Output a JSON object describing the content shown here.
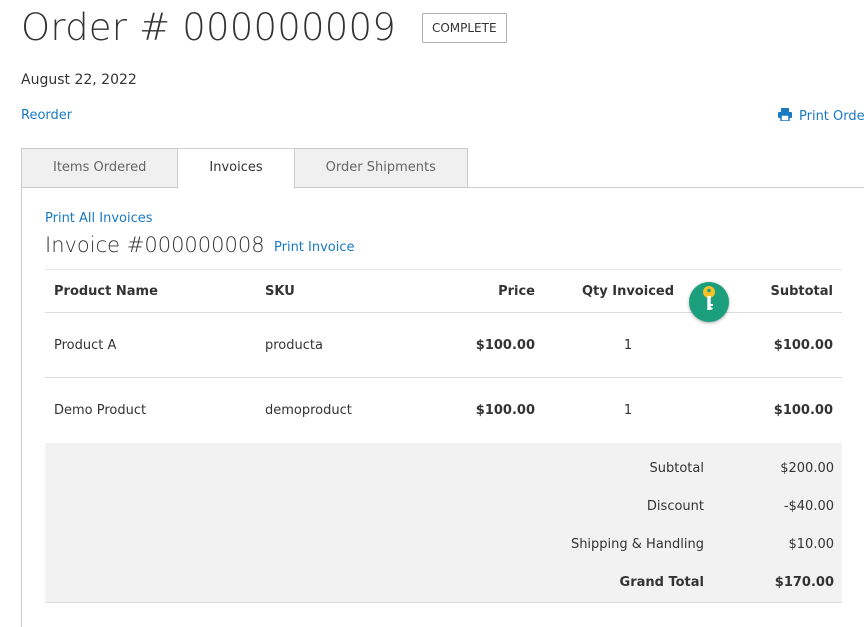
{
  "order": {
    "title": "Order # 000000009",
    "status": "COMPLETE",
    "date": "August 22, 2022",
    "reorder_label": "Reorder",
    "print_order_label": "Print Order"
  },
  "tabs": [
    {
      "label": "Items Ordered"
    },
    {
      "label": "Invoices"
    },
    {
      "label": "Order Shipments"
    }
  ],
  "active_tab": "Invoices",
  "invoice": {
    "print_all_label": "Print All Invoices",
    "title": "Invoice #000000008",
    "print_label": "Print Invoice",
    "columns": {
      "name": "Product Name",
      "sku": "SKU",
      "price": "Price",
      "qty": "Qty Invoiced",
      "subtotal": "Subtotal"
    },
    "items": [
      {
        "name": "Product A",
        "sku": "producta",
        "price": "$100.00",
        "qty": "1",
        "subtotal": "$100.00"
      },
      {
        "name": "Demo Product",
        "sku": "demoproduct",
        "price": "$100.00",
        "qty": "1",
        "subtotal": "$100.00"
      }
    ],
    "totals": [
      {
        "label": "Subtotal",
        "value": "$200.00"
      },
      {
        "label": "Discount",
        "value": "-$40.00"
      },
      {
        "label": "Shipping & Handling",
        "value": "$10.00"
      },
      {
        "label": "Grand Total",
        "value": "$170.00"
      }
    ]
  },
  "icons": {
    "print": "printer-icon",
    "key_badge": "key-icon"
  },
  "colors": {
    "link": "#1979c3",
    "key_badge": "#1b9f7d",
    "key": "#f6c225",
    "totals_bg": "#f2f2f2"
  }
}
